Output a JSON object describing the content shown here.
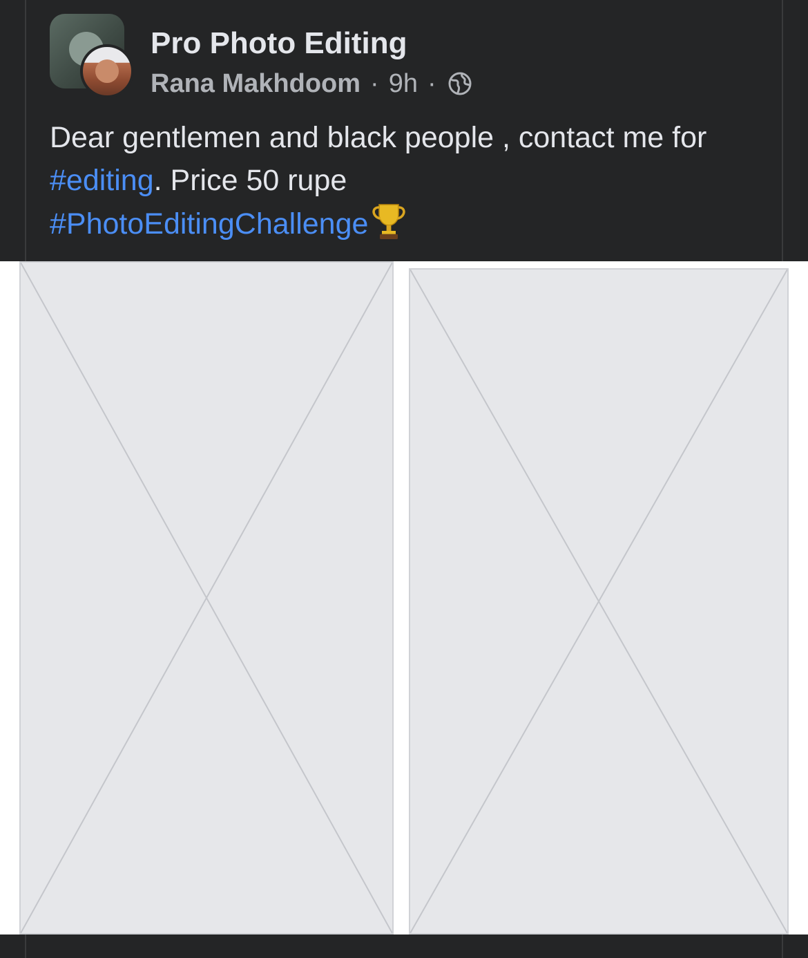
{
  "post": {
    "page_name": "Pro Photo Editing",
    "author": "Rana Makhdoom",
    "time": "9h",
    "separator": "·",
    "audience_icon": "globe-icon",
    "text": {
      "before": "Dear gentlemen and black people , contact me for ",
      "hashtag_1": "#editing",
      "middle": ". Price 50 rupe",
      "hashtag_2": "#PhotoEditingChallenge",
      "emoji": "trophy-icon"
    }
  },
  "media": {
    "photos": [
      "before-photo",
      "after-photo"
    ]
  },
  "colors": {
    "background": "#18191a",
    "card": "#242526",
    "text": "#e4e6eb",
    "secondary_text": "#b0b3b8",
    "link": "#4b8ef5"
  }
}
